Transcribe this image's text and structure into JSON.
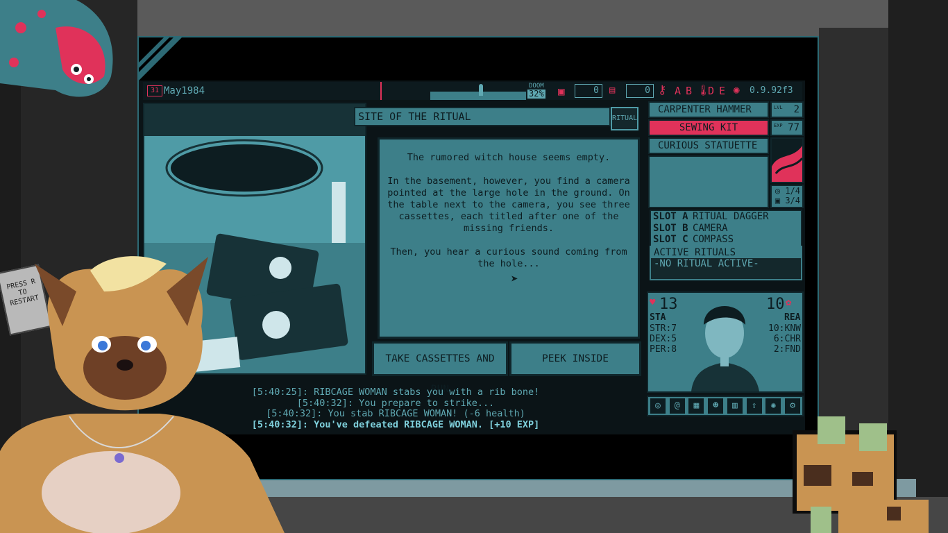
{
  "topbar": {
    "day": "31",
    "date": "May1984",
    "doom_label": "DOOM",
    "doom_value": "32%",
    "counter1": "0",
    "counter2": "0",
    "letters": [
      "A",
      "B",
      "D",
      "E"
    ],
    "version": "0.9.92f3"
  },
  "location": {
    "title": "SITE OF THE RITUAL",
    "icon_text": "RITUAL"
  },
  "story": {
    "paragraphs": [
      "The rumored witch house seems empty.",
      "In the basement, however, you find a camera pointed at the large hole in the ground. On the table next to the camera, you see three cassettes, each titled after one of the missing friends.",
      "Then, you hear a curious sound coming from the hole..."
    ]
  },
  "choices": {
    "left": "TAKE CASSETTES AND RUN",
    "right": "PEEK INSIDE"
  },
  "log": [
    "[5:40:25]: RIBCAGE WOMAN stabs you with a rib bone!",
    "[5:40:32]: You prepare to strike...",
    "[5:40:32]: You stab RIBCAGE WOMAN! (-6 health)",
    "[5:40:32]: You've defeated RIBCAGE WOMAN. [+10 EXP]"
  ],
  "inventory": {
    "items": [
      "CARPENTER HAMMER",
      "SEWING KIT",
      "CURIOUS STATUETTE"
    ],
    "level_label": "LVL",
    "level": "2",
    "exp_label": "EXP",
    "exp": "77",
    "count1": "1/4",
    "count2": "3/4"
  },
  "slots": [
    {
      "key": "SLOT A",
      "value": "RITUAL DAGGER"
    },
    {
      "key": "SLOT B",
      "value": "CAMERA"
    },
    {
      "key": "SLOT C",
      "value": "COMPASS"
    }
  ],
  "rituals": {
    "header": "ACTIVE RITUALS",
    "value": "-NO RITUAL ACTIVE-"
  },
  "stats": {
    "sta": "13",
    "sta_label": "STA",
    "rea": "10",
    "rea_label": "REA",
    "left": [
      "STR:7",
      "DEX:5",
      "PER:8"
    ],
    "right": [
      "10:KNW",
      "6:CHR",
      "2:FND"
    ]
  },
  "overlay": {
    "sign_text": "PRESS R TO RESTART"
  },
  "colors": {
    "teal": "#3d7f89",
    "teal_light": "#5fa8b2",
    "accent_red": "#e0325a",
    "dark": "#0d1d21"
  }
}
